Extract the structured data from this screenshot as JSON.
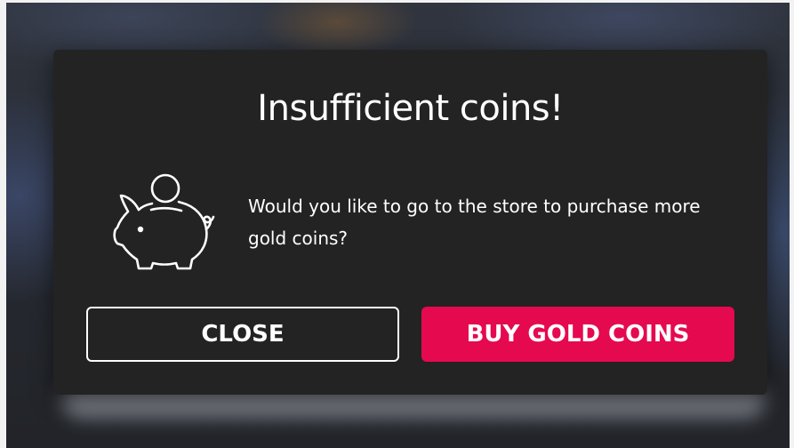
{
  "dialog": {
    "title": "Insufficient coins!",
    "message": "Would you like to go to the store to purchase more gold coins?",
    "icon": "piggy-bank-icon",
    "close_label": "CLOSE",
    "buy_label": "BUY GOLD COINS"
  },
  "colors": {
    "modal_background": "#232323",
    "primary_button": "#e5094f",
    "text": "#ffffff"
  }
}
